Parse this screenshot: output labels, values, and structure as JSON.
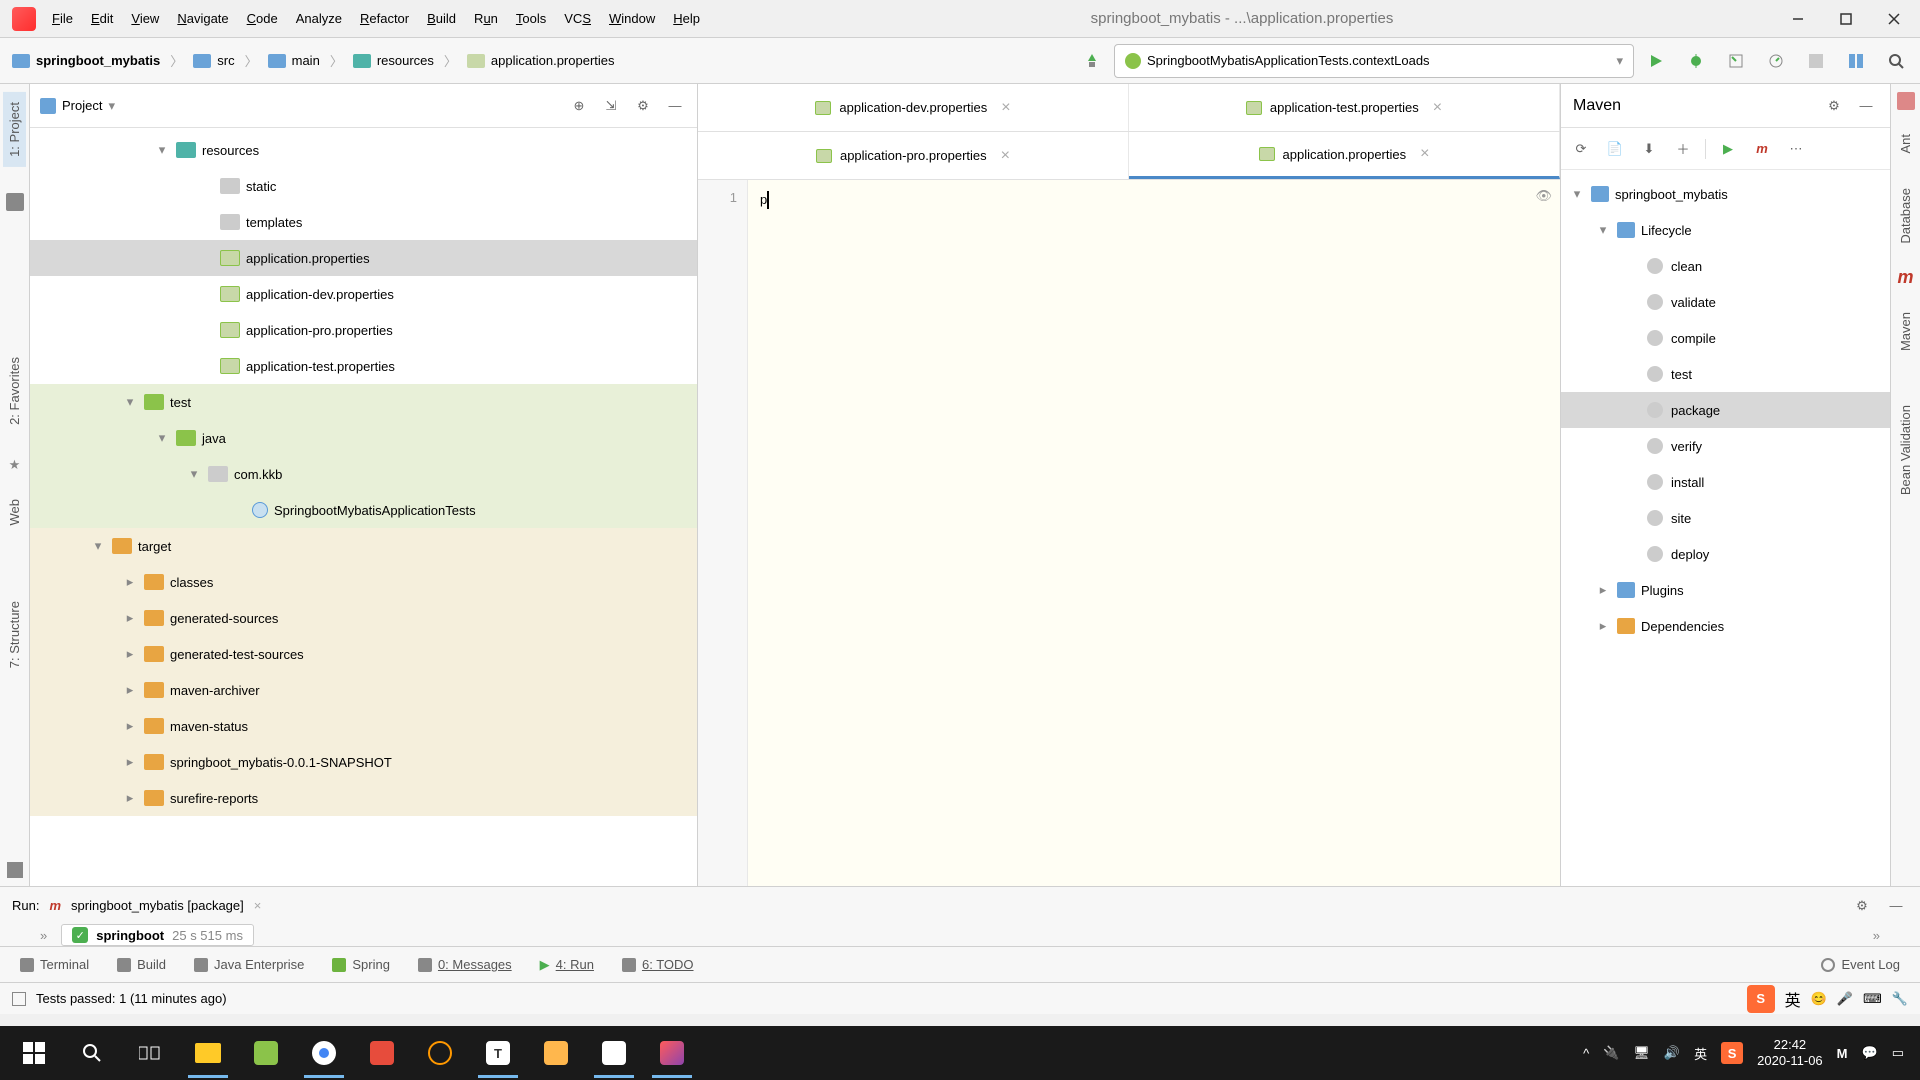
{
  "colors": {
    "accent": "#4a88c7",
    "green": "#4caf50"
  },
  "title": "springboot_mybatis - ...\\application.properties",
  "menu": {
    "file": "File",
    "edit": "Edit",
    "view": "View",
    "navigate": "Navigate",
    "code": "Code",
    "analyze": "Analyze",
    "refactor": "Refactor",
    "build": "Build",
    "run": "Run",
    "tools": "Tools",
    "vcs": "VCS",
    "window": "Window",
    "help": "Help"
  },
  "breadcrumb": [
    "springboot_mybatis",
    "src",
    "main",
    "resources",
    "application.properties"
  ],
  "run_config": "SpringbootMybatisApplicationTests.contextLoads",
  "project": {
    "label": "Project",
    "tree": {
      "resources": "resources",
      "static": "static",
      "templates": "templates",
      "app_props": "application.properties",
      "app_dev": "application-dev.properties",
      "app_pro": "application-pro.properties",
      "app_test": "application-test.properties",
      "test": "test",
      "java": "java",
      "com_kkb": "com.kkb",
      "test_class": "SpringbootMybatisApplicationTests",
      "target": "target",
      "classes": "classes",
      "gen_sources": "generated-sources",
      "gen_test_sources": "generated-test-sources",
      "maven_archiver": "maven-archiver",
      "maven_status": "maven-status",
      "snapshot": "springboot_mybatis-0.0.1-SNAPSHOT",
      "surefire": "surefire-reports"
    }
  },
  "tabs": {
    "dev": "application-dev.properties",
    "test": "application-test.properties",
    "pro": "application-pro.properties",
    "props": "application.properties"
  },
  "editor": {
    "line1": "1",
    "content": "p"
  },
  "maven": {
    "label": "Maven",
    "root": "springboot_mybatis",
    "lifecycle": "Lifecycle",
    "goals": {
      "clean": "clean",
      "validate": "validate",
      "compile": "compile",
      "test": "test",
      "package": "package",
      "verify": "verify",
      "install": "install",
      "site": "site",
      "deploy": "deploy"
    },
    "plugins": "Plugins",
    "dependencies": "Dependencies"
  },
  "left_tabs": {
    "project": "1: Project",
    "favorites": "2: Favorites",
    "web": "Web",
    "structure": "7: Structure"
  },
  "right_tabs": {
    "ant": "Ant",
    "database": "Database",
    "maven": "m",
    "bean": "Bean Validation"
  },
  "run_panel": {
    "label": "Run:",
    "config": "springboot_mybatis [package]",
    "result_name": "springboot",
    "result_time": "25 s 515 ms"
  },
  "bottom_tabs": {
    "terminal": "Terminal",
    "build": "Build",
    "java_ee": "Java Enterprise",
    "spring": "Spring",
    "messages": "0: Messages",
    "run": "4: Run",
    "todo": "6: TODO",
    "event_log": "Event Log"
  },
  "status": "Tests passed: 1 (11 minutes ago)",
  "tray": {
    "ime": "英",
    "time": "22:42",
    "date": "2020-11-06"
  }
}
